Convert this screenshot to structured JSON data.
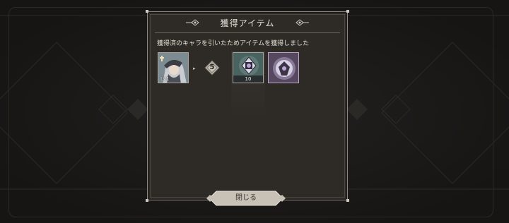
{
  "dialog": {
    "title": "獲得アイテム",
    "message": "獲得済のキャラを引いたためアイテムを獲得しました"
  },
  "items": {
    "character": {
      "level": "Lv1",
      "icon": "character-portrait-icon"
    },
    "conversion_badge": "5",
    "reward_card": {
      "quantity": "10",
      "icon": "card-item-icon"
    },
    "reward_gem": {
      "icon": "gem-item-icon"
    }
  },
  "close_button": {
    "label": "閉じる"
  },
  "colors": {
    "panel": "#2e2b27",
    "border": "#8d8982",
    "text": "#e6e0d5",
    "button": "#c7c1b6"
  }
}
